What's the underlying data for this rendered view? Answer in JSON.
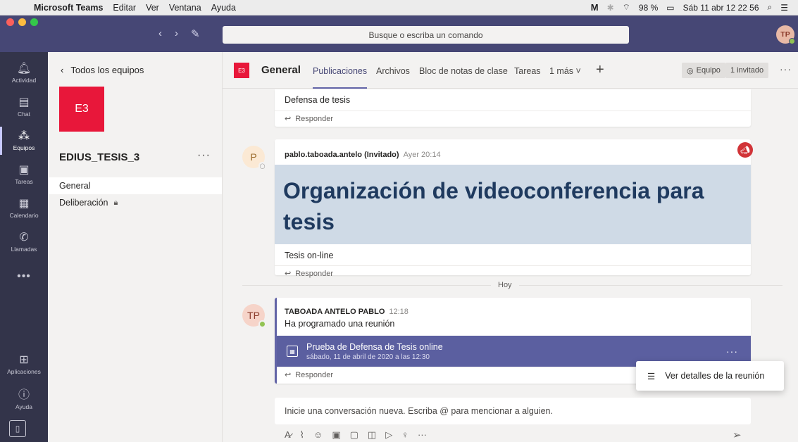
{
  "menubar": {
    "app": "Microsoft Teams",
    "items": [
      "Editar",
      "Ver",
      "Ventana",
      "Ayuda"
    ],
    "battery": "98 %",
    "datetime": "Sáb 11 abr  12 22 56"
  },
  "titlebar": {
    "search_placeholder": "Busque o escriba un comando",
    "avatar_initials": "TP"
  },
  "rail": {
    "items": [
      {
        "label": "Actividad"
      },
      {
        "label": "Chat"
      },
      {
        "label": "Equipos"
      },
      {
        "label": "Tareas"
      },
      {
        "label": "Calendario"
      },
      {
        "label": "Llamadas"
      }
    ],
    "apps_label": "Aplicaciones",
    "help_label": "Ayuda"
  },
  "sidebar": {
    "back_label": "Todos los equipos",
    "team_initials": "E3",
    "team_name": "EDIUS_TESIS_3",
    "channels": [
      {
        "label": "General"
      },
      {
        "label": "Deliberación"
      }
    ]
  },
  "header": {
    "tile": "E3",
    "channel": "General",
    "tabs": [
      {
        "label": "Publicaciones"
      },
      {
        "label": "Archivos"
      },
      {
        "label": "Bloc de notas de clase"
      },
      {
        "label": "Tareas"
      },
      {
        "label": "1 más"
      }
    ],
    "team_button": "Equipo",
    "guest_button": "1 invitado"
  },
  "messages": {
    "first_text": "Defensa de tesis",
    "reply_label": "Responder",
    "post1": {
      "avatar": "P",
      "author": "pablo.taboada.antelo (Invitado)",
      "time": "Ayer 20:14",
      "subject": "Organización de videoconferencia para tesis",
      "body": "Tesis on-line"
    },
    "divider": "Hoy",
    "post2": {
      "avatar": "TP",
      "author": "TABOADA ANTELO PABLO",
      "time": "12:18",
      "body": "Ha programado una reunión",
      "meeting_title": "Prueba de Defensa de Tesis online",
      "meeting_when": "sábado, 11 de abril de 2020 a las 12:30"
    },
    "popup_label": "Ver detalles de la reunión"
  },
  "compose": {
    "placeholder": "Inicie una conversación nueva. Escriba @ para mencionar a alguien."
  }
}
